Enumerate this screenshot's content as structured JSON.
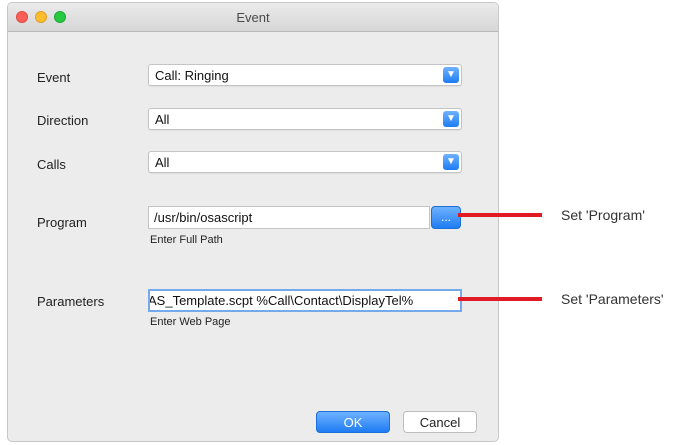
{
  "window": {
    "title": "Event"
  },
  "form": {
    "event": {
      "label": "Event",
      "value": "Call: Ringing"
    },
    "direction": {
      "label": "Direction",
      "value": "All"
    },
    "calls": {
      "label": "Calls",
      "value": "All"
    },
    "program": {
      "label": "Program",
      "value": "/usr/bin/osascript",
      "hint": "Enter Full Path",
      "browse_label": "..."
    },
    "parameters": {
      "label": "Parameters",
      "value": "AS_Template.scpt %Call\\Contact\\DisplayTel%",
      "hint": "Enter Web Page"
    }
  },
  "buttons": {
    "ok": "OK",
    "cancel": "Cancel"
  },
  "annotations": {
    "program": "Set 'Program'",
    "parameters": "Set 'Parameters'"
  },
  "colors": {
    "accent": "#1f7cf3",
    "pointer": "#e01b24"
  }
}
